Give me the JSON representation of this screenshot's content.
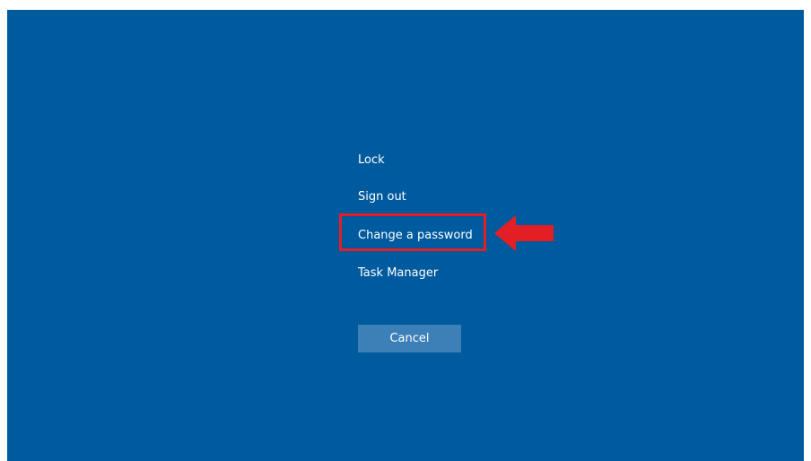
{
  "menu": {
    "lock": "Lock",
    "sign_out": "Sign out",
    "change_password": "Change a password",
    "task_manager": "Task Manager"
  },
  "cancel_label": "Cancel",
  "colors": {
    "background": "#005a9e",
    "button": "#3d80b8",
    "annotation": "#e31e24",
    "text": "#ffffff"
  },
  "annotation": {
    "highlighted_item": "change_password",
    "arrow_icon": "red-arrow-left-icon"
  }
}
